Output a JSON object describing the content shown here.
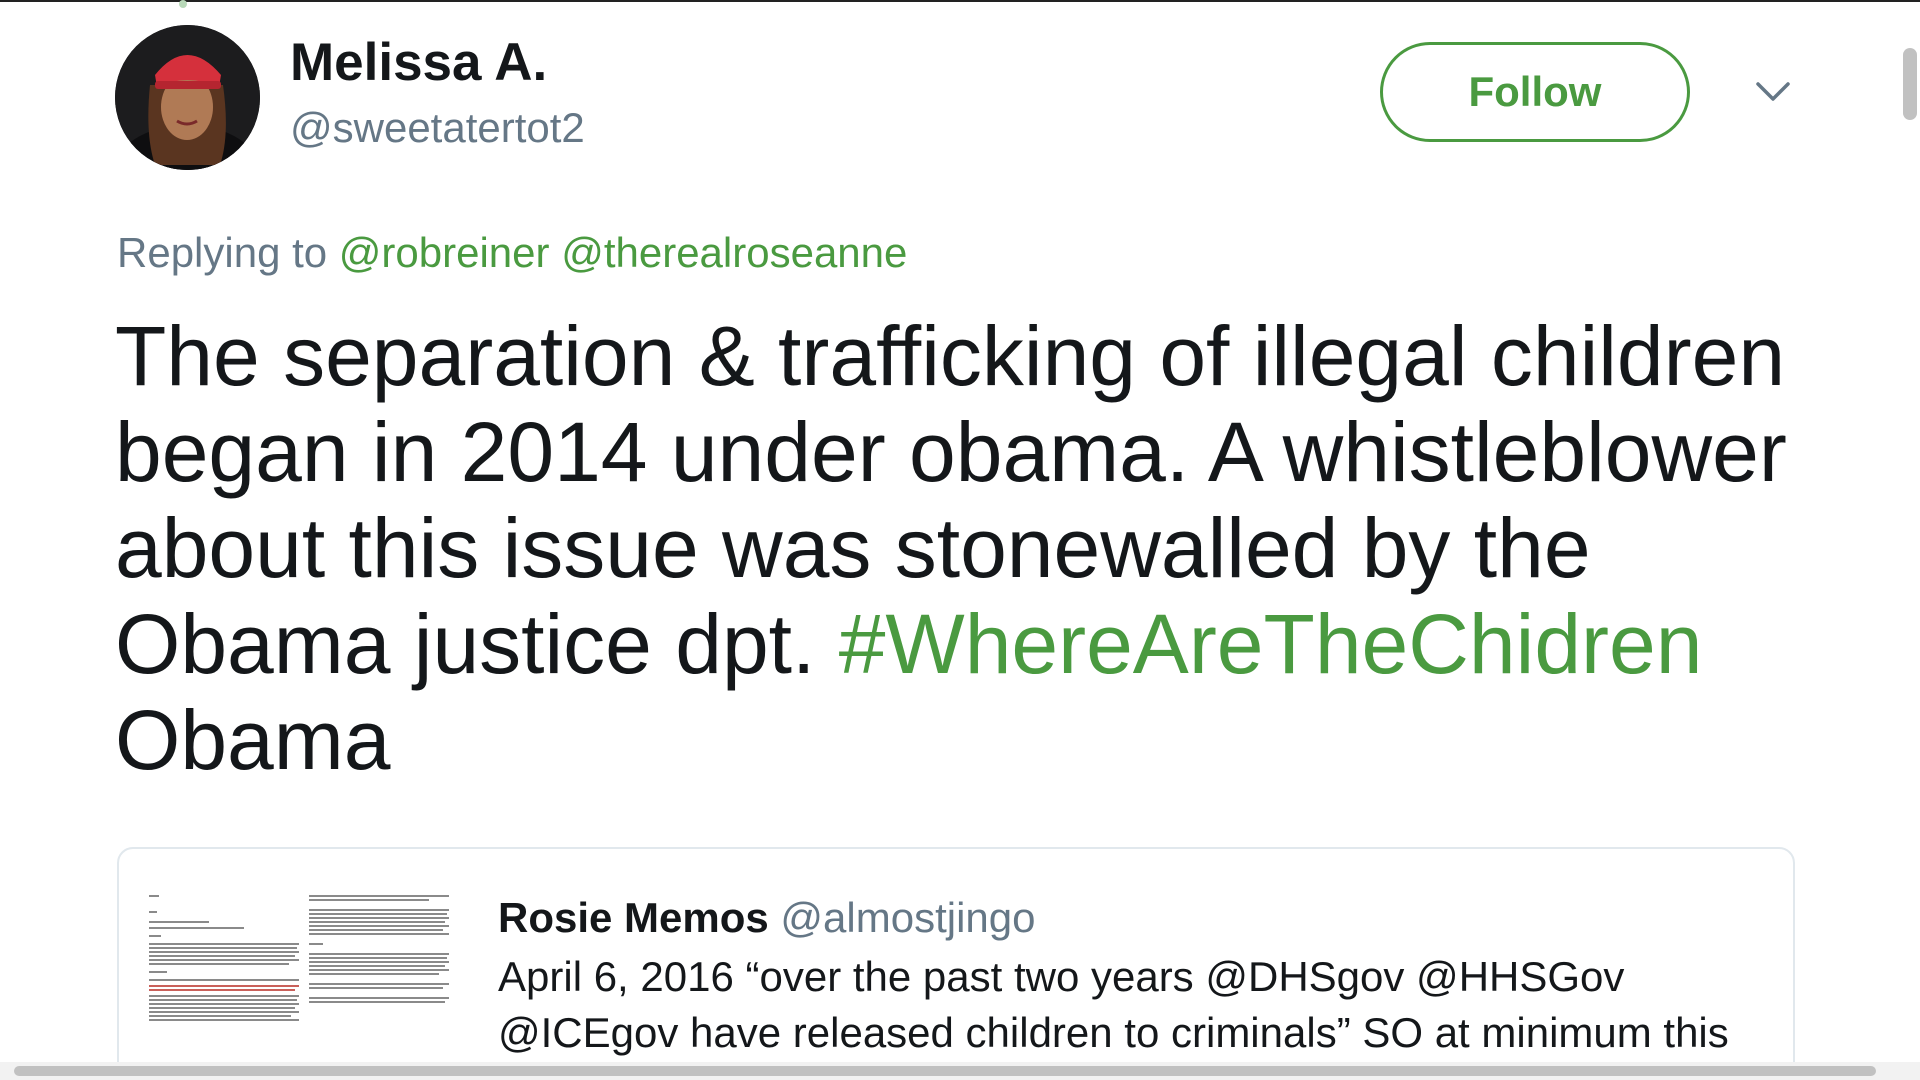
{
  "colors": {
    "accent": "#4a9a40",
    "text_primary": "#14171a",
    "text_secondary": "#657786",
    "border": "#e1e8ed"
  },
  "author": {
    "display_name": "Melissa A.",
    "handle": "@sweetatertot2",
    "avatar_icon": "user-avatar"
  },
  "follow_button": {
    "label": "Follow"
  },
  "more_menu": {
    "icon": "chevron-down-icon"
  },
  "reply_context": {
    "prefix": "Replying to",
    "mentions": [
      "@robreiner",
      "@therealroseanne"
    ]
  },
  "tweet": {
    "text": "The separation & trafficking of illegal children began in 2014 under obama. A whistleblower about this issue was stonewalled by the Obama justice dpt.",
    "hashtag": "#WhereAreTheChidren",
    "tail": "Obama"
  },
  "quoted_tweet": {
    "name": "Rosie Memos",
    "handle": "@almostjingo",
    "text": "April 6, 2016 “over the past two years @DHSgov @HHSGov @ICEgov have released children to criminals” SO at minimum this",
    "thumbnail_icon": "document-image"
  }
}
